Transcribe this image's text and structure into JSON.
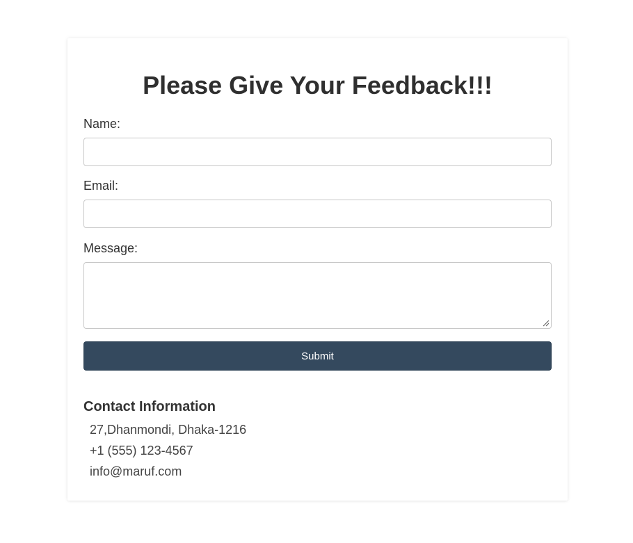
{
  "form": {
    "title": "Please Give Your Feedback!!!",
    "name_label": "Name:",
    "name_value": "",
    "email_label": "Email:",
    "email_value": "",
    "message_label": "Message:",
    "message_value": "",
    "submit_label": "Submit"
  },
  "contact": {
    "heading": "Contact Information",
    "address": "27,Dhanmondi, Dhaka-1216",
    "phone": "+1 (555) 123-4567",
    "email": "info@maruf.com"
  },
  "colors": {
    "button_bg": "#34495e",
    "button_text": "#ffffff",
    "title_text": "#2f2f2f",
    "input_border": "#c8c8c8"
  }
}
